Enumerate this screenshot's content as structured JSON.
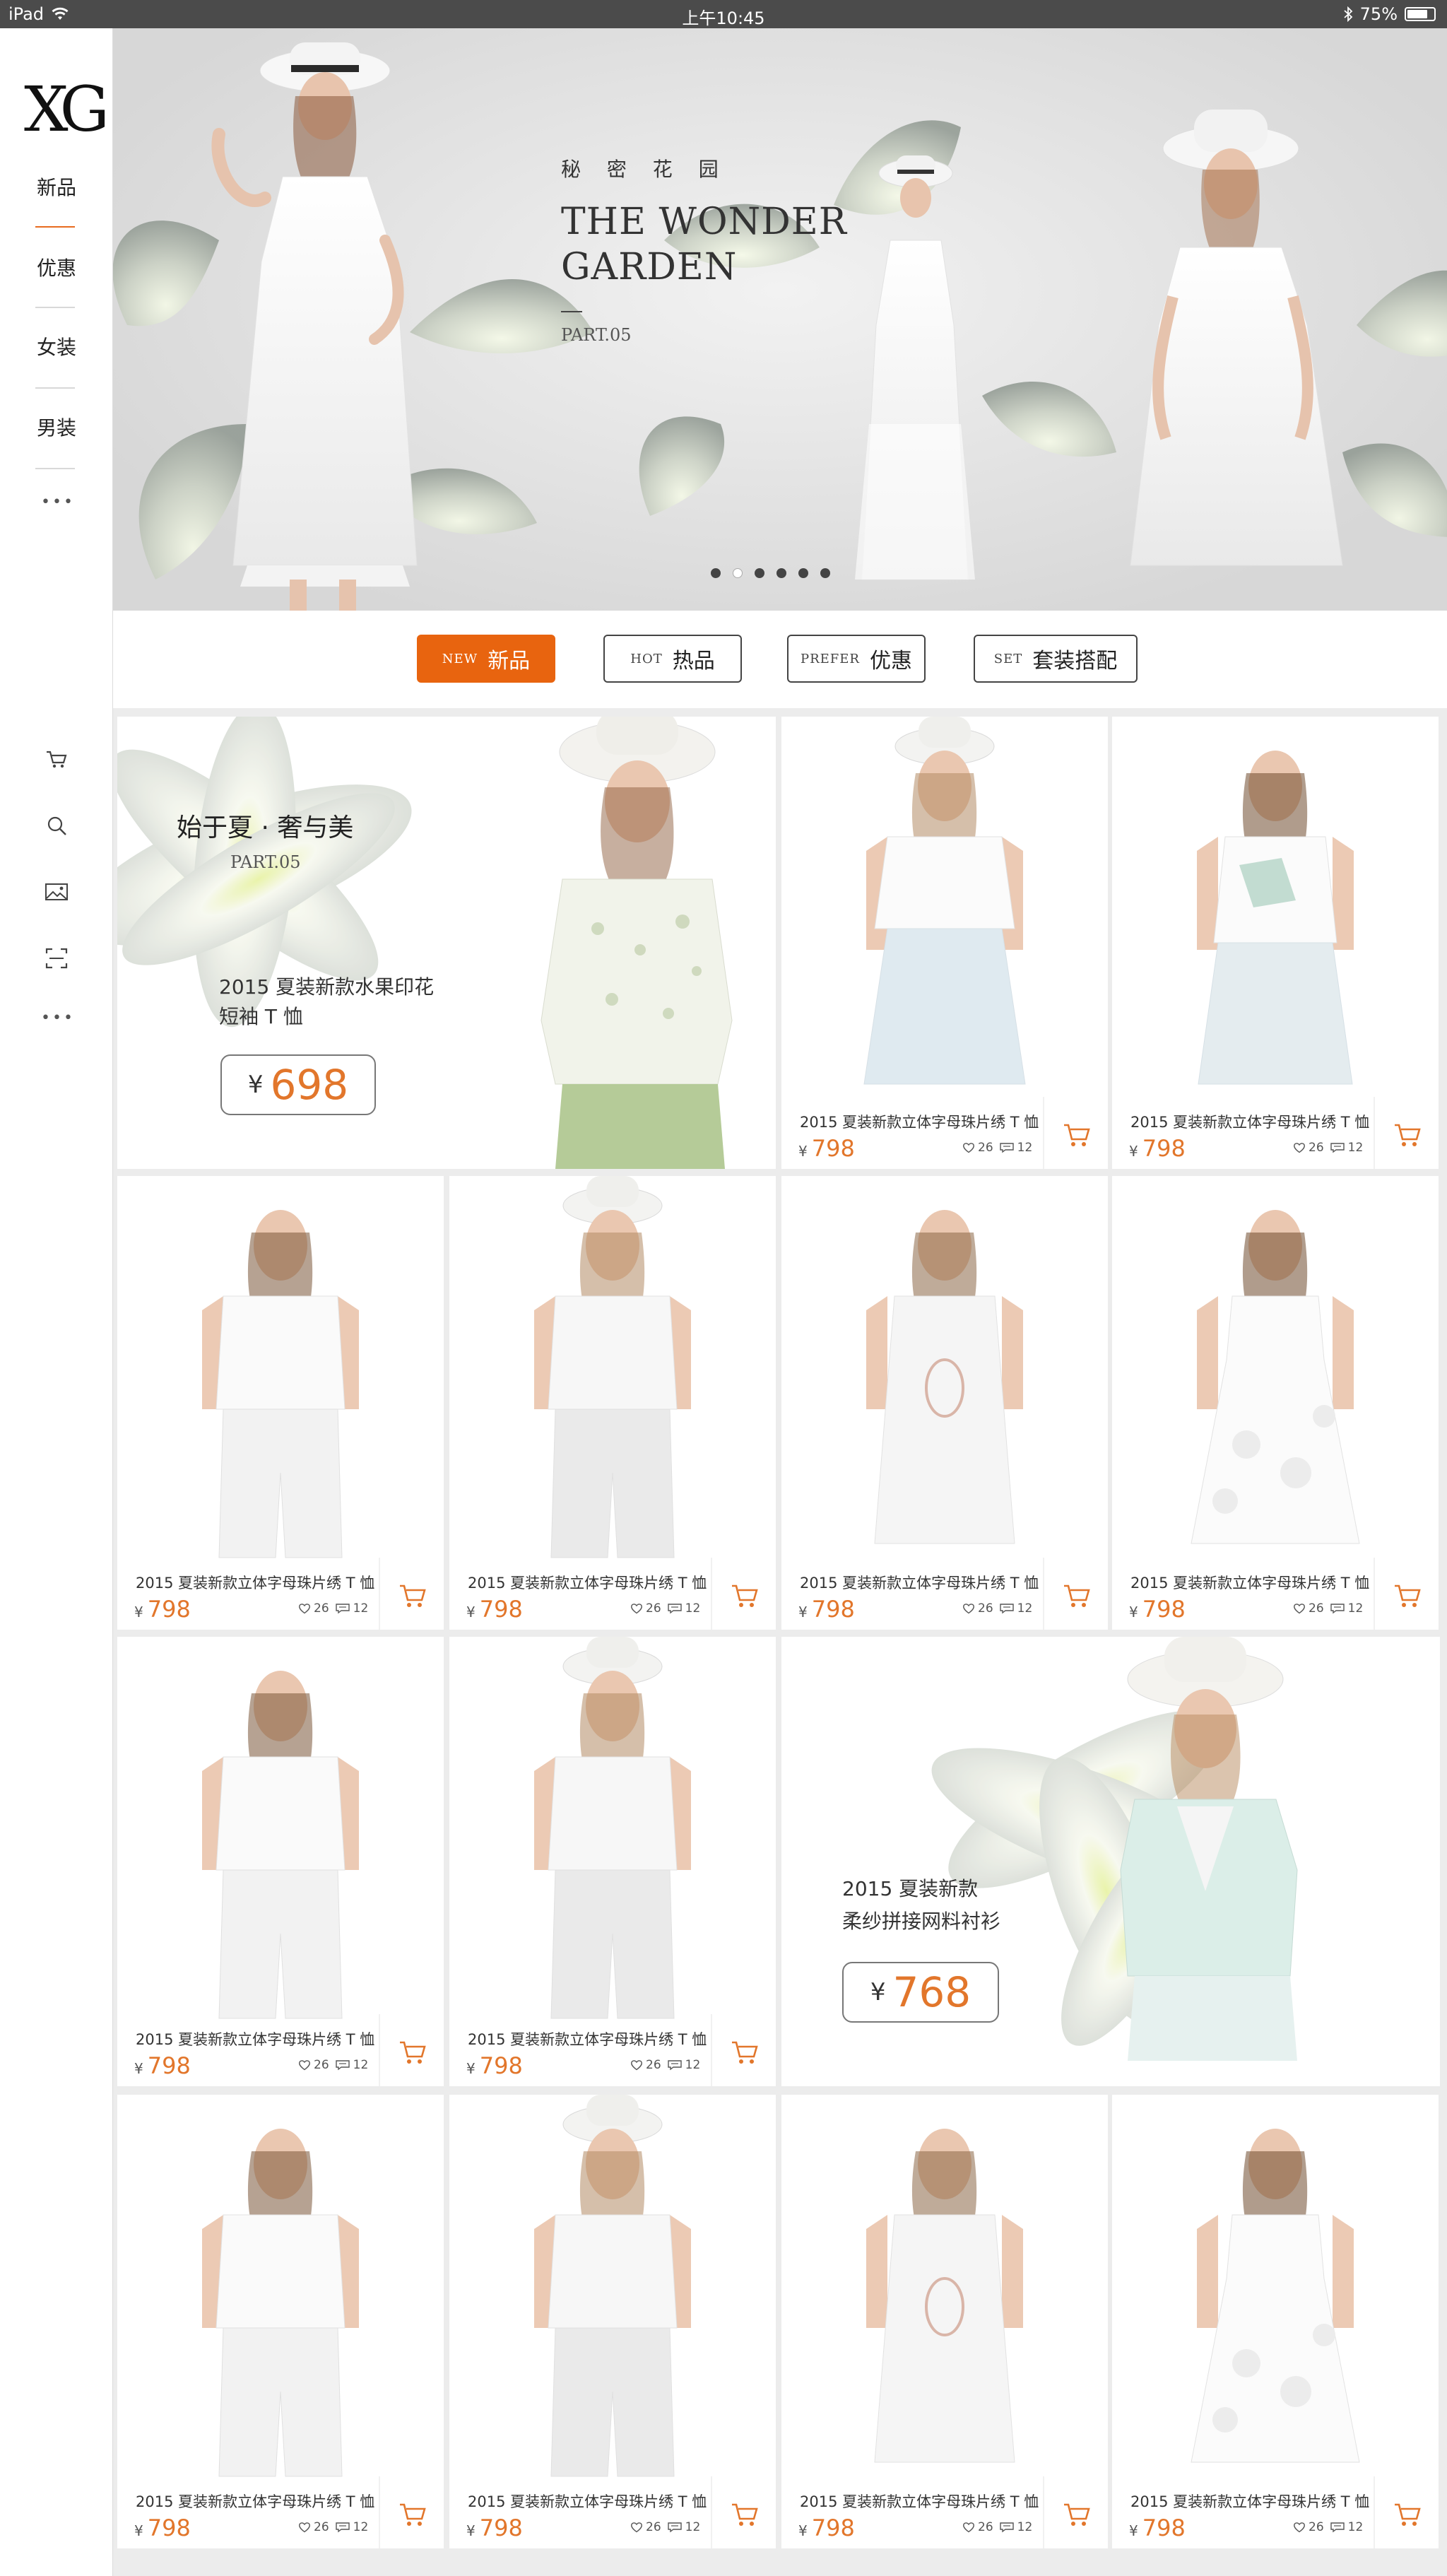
{
  "status": {
    "device": "iPad",
    "time": "上午10:45",
    "battery": "75%"
  },
  "sidebar": {
    "logo": "XG",
    "nav": [
      {
        "label": "新品"
      },
      {
        "label": "优惠"
      },
      {
        "label": "女装"
      },
      {
        "label": "男装"
      }
    ],
    "more": "•••",
    "tools": [
      "cart-icon",
      "search-icon",
      "image-icon",
      "scan-icon",
      "more-icon"
    ]
  },
  "banner": {
    "subtitle_cn": "秘 密 花 园",
    "title_line1": "THE WONDER",
    "title_line2": "GARDEN",
    "part": "PART.05",
    "slide_count": 6,
    "active_slide": 2
  },
  "tabs": [
    {
      "en": "NEW",
      "zh": "新品",
      "active": true
    },
    {
      "en": "HOT",
      "zh": "热品",
      "active": false
    },
    {
      "en": "PREFER",
      "zh": "优惠",
      "active": false
    },
    {
      "en": "SET",
      "zh": "套装搭配",
      "active": false
    }
  ],
  "promo1": {
    "title": "始于夏 · 奢与美",
    "part": "PART.05",
    "desc1": "2015 夏装新款水果印花",
    "desc2": "短袖 T 恤",
    "currency": "¥",
    "price": "698"
  },
  "promo2": {
    "desc1": "2015 夏装新款",
    "desc2": "柔纱拼接网料衬衫",
    "currency": "¥",
    "price": "768"
  },
  "product": {
    "name": "2015 夏装新款立体字母珠片绣 T 恤",
    "currency": "¥",
    "price": "798",
    "likes": "26",
    "comments": "12"
  },
  "colors": {
    "accent": "#e8640f",
    "price": "#e2762b",
    "status_bar": "#4b4b4b"
  }
}
